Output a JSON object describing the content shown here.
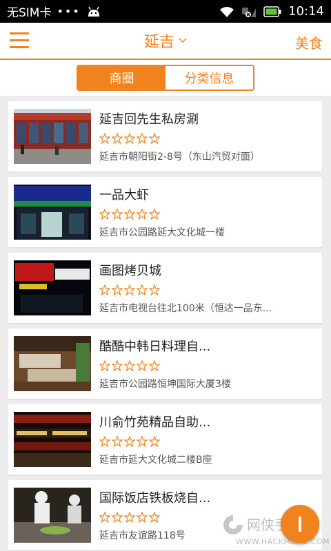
{
  "status_bar": {
    "carrier": "无SIM卡",
    "dots": "•••",
    "time": "10:14"
  },
  "header": {
    "city": "延吉",
    "category": "美食"
  },
  "tabs": [
    {
      "label": "商圈",
      "active": true
    },
    {
      "label": "分类信息",
      "active": false
    }
  ],
  "listings": [
    {
      "name": "延吉回先生私房涮",
      "address": "延吉市朝阳街2-8号（东山汽贸对面）",
      "rating": 0
    },
    {
      "name": "一品大虾",
      "address": "延吉市公园路延大文化城一楼",
      "rating": 0
    },
    {
      "name": "画图烤贝城",
      "address": "延吉市电视台往北100米（恒达一品东...",
      "rating": 0
    },
    {
      "name": "酷酷中韩日料理自...",
      "address": "延吉市公园路恒坤国际大厦3楼",
      "rating": 0
    },
    {
      "name": "川俞竹苑精品自助...",
      "address": "延吉市延大文化城二楼B座",
      "rating": 0
    },
    {
      "name": "国际饭店铁板烧自...",
      "address": "延吉市友谊路118号",
      "rating": 0
    }
  ],
  "watermark": {
    "text": "网侠手机站",
    "url": "WWW.HACKHOME.COM"
  },
  "colors": {
    "accent": "#f0831e",
    "star": "#f0831e"
  }
}
